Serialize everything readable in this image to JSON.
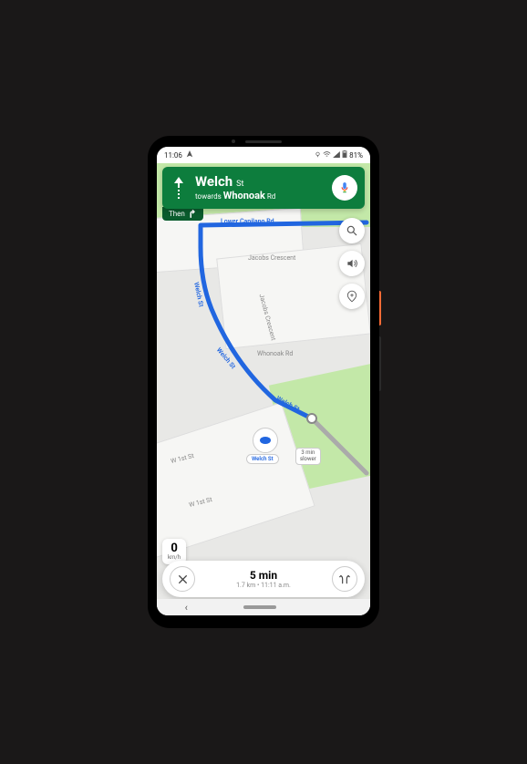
{
  "status": {
    "time": "11:06",
    "battery": "81%",
    "icons": [
      "location",
      "wifi",
      "signal",
      "battery"
    ]
  },
  "nav": {
    "street": "Welch",
    "street_suffix": "St",
    "towards_prefix": "towards",
    "towards_street": "Whonoak",
    "towards_suffix": "Rd",
    "then_label": "Then"
  },
  "map": {
    "labels": {
      "lower_capilano": "Lower Capilano Rd",
      "jacobs_cres": "Jacobs Crescent",
      "jacobs_cres2": "Jacobs Crescent",
      "welch1": "Welch St",
      "welch2": "Welch St",
      "welch3": "Welch St",
      "whonoak": "Whonoak Rd",
      "w1st_a": "W 1st St",
      "w1st_b": "W 1st St"
    },
    "pin_label": "Welch St",
    "alt_route": {
      "line1": "3 min",
      "line2": "slower"
    }
  },
  "speed": {
    "value": "0",
    "unit": "km/h"
  },
  "trip": {
    "eta": "5 min",
    "distance": "1.7 km",
    "separator": "•",
    "arrival": "11:11 a.m."
  },
  "colors": {
    "nav_green": "#0d7d3d",
    "route_blue": "#2166e0",
    "park_green": "#c3e8a8"
  }
}
